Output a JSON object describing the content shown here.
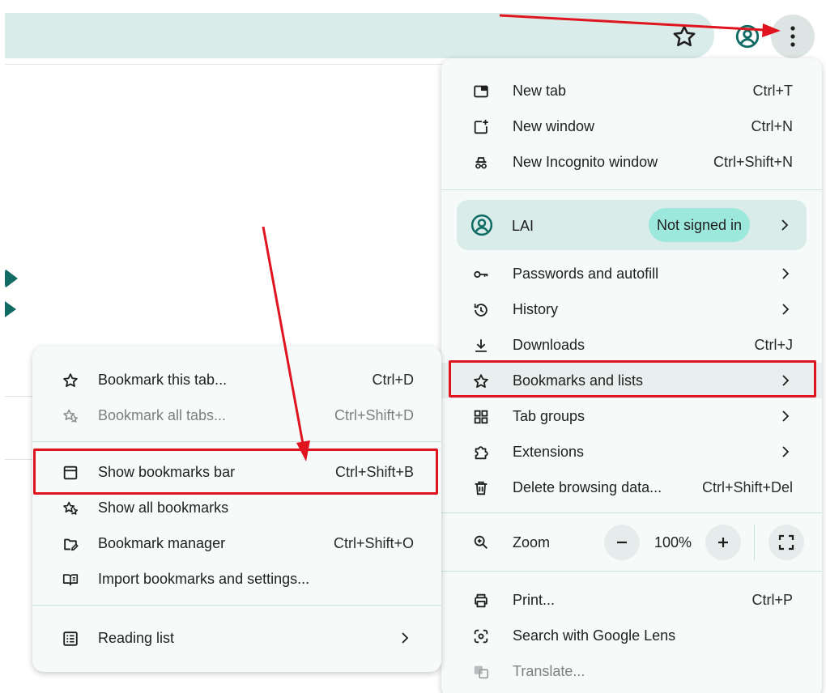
{
  "colors": {
    "accent": "#0f6b63",
    "omnibox": "#d9ece9",
    "menu_bg": "#f6fbfa",
    "badge": "#9de8dc",
    "annotation": "#e0141e"
  },
  "toolbar": {
    "star_icon": "star-icon",
    "profile_icon": "profile-icon",
    "menu_icon": "more-vert-icon"
  },
  "main_menu": {
    "items_top": [
      {
        "label": "New tab",
        "shortcut": "Ctrl+T",
        "icon": "new-tab-icon"
      },
      {
        "label": "New window",
        "shortcut": "Ctrl+N",
        "icon": "new-window-icon"
      },
      {
        "label": "New Incognito window",
        "shortcut": "Ctrl+Shift+N",
        "icon": "incognito-icon"
      }
    ],
    "profile": {
      "name": "LAI",
      "status": "Not signed in",
      "icon": "profile-icon"
    },
    "items_mid": [
      {
        "label": "Passwords and autofill",
        "shortcut": "",
        "icon": "key-icon",
        "submenu": true
      },
      {
        "label": "History",
        "shortcut": "",
        "icon": "history-icon",
        "submenu": true
      },
      {
        "label": "Downloads",
        "shortcut": "Ctrl+J",
        "icon": "download-icon"
      },
      {
        "label": "Bookmarks and lists",
        "shortcut": "",
        "icon": "star-icon",
        "submenu": true
      },
      {
        "label": "Tab groups",
        "shortcut": "",
        "icon": "tab-groups-icon",
        "submenu": true
      },
      {
        "label": "Extensions",
        "shortcut": "",
        "icon": "extension-icon",
        "submenu": true
      },
      {
        "label": "Delete browsing data...",
        "shortcut": "Ctrl+Shift+Del",
        "icon": "trash-icon"
      }
    ],
    "zoom": {
      "label": "Zoom",
      "value": "100%",
      "minus": "−",
      "plus": "+"
    },
    "items_bottom": [
      {
        "label": "Print...",
        "shortcut": "Ctrl+P",
        "icon": "print-icon"
      },
      {
        "label": "Search with Google Lens",
        "shortcut": "",
        "icon": "lens-icon"
      },
      {
        "label": "Translate...",
        "shortcut": "",
        "icon": "translate-icon",
        "disabled": true
      }
    ]
  },
  "bookmarks_submenu": {
    "items": [
      {
        "label": "Bookmark this tab...",
        "shortcut": "Ctrl+D",
        "icon": "star-icon"
      },
      {
        "label": "Bookmark all tabs...",
        "shortcut": "Ctrl+Shift+D",
        "icon": "stars-icon",
        "disabled": true
      },
      {
        "label": "Show bookmarks bar",
        "shortcut": "Ctrl+Shift+B",
        "icon": "bookmarks-bar-icon"
      },
      {
        "label": "Show all bookmarks",
        "shortcut": "",
        "icon": "stars-icon"
      },
      {
        "label": "Bookmark manager",
        "shortcut": "Ctrl+Shift+O",
        "icon": "folder-edit-icon"
      },
      {
        "label": "Import bookmarks and settings...",
        "shortcut": "",
        "icon": "book-icon"
      },
      {
        "label": "Reading list",
        "shortcut": "",
        "icon": "reading-list-icon",
        "submenu": true
      }
    ]
  }
}
